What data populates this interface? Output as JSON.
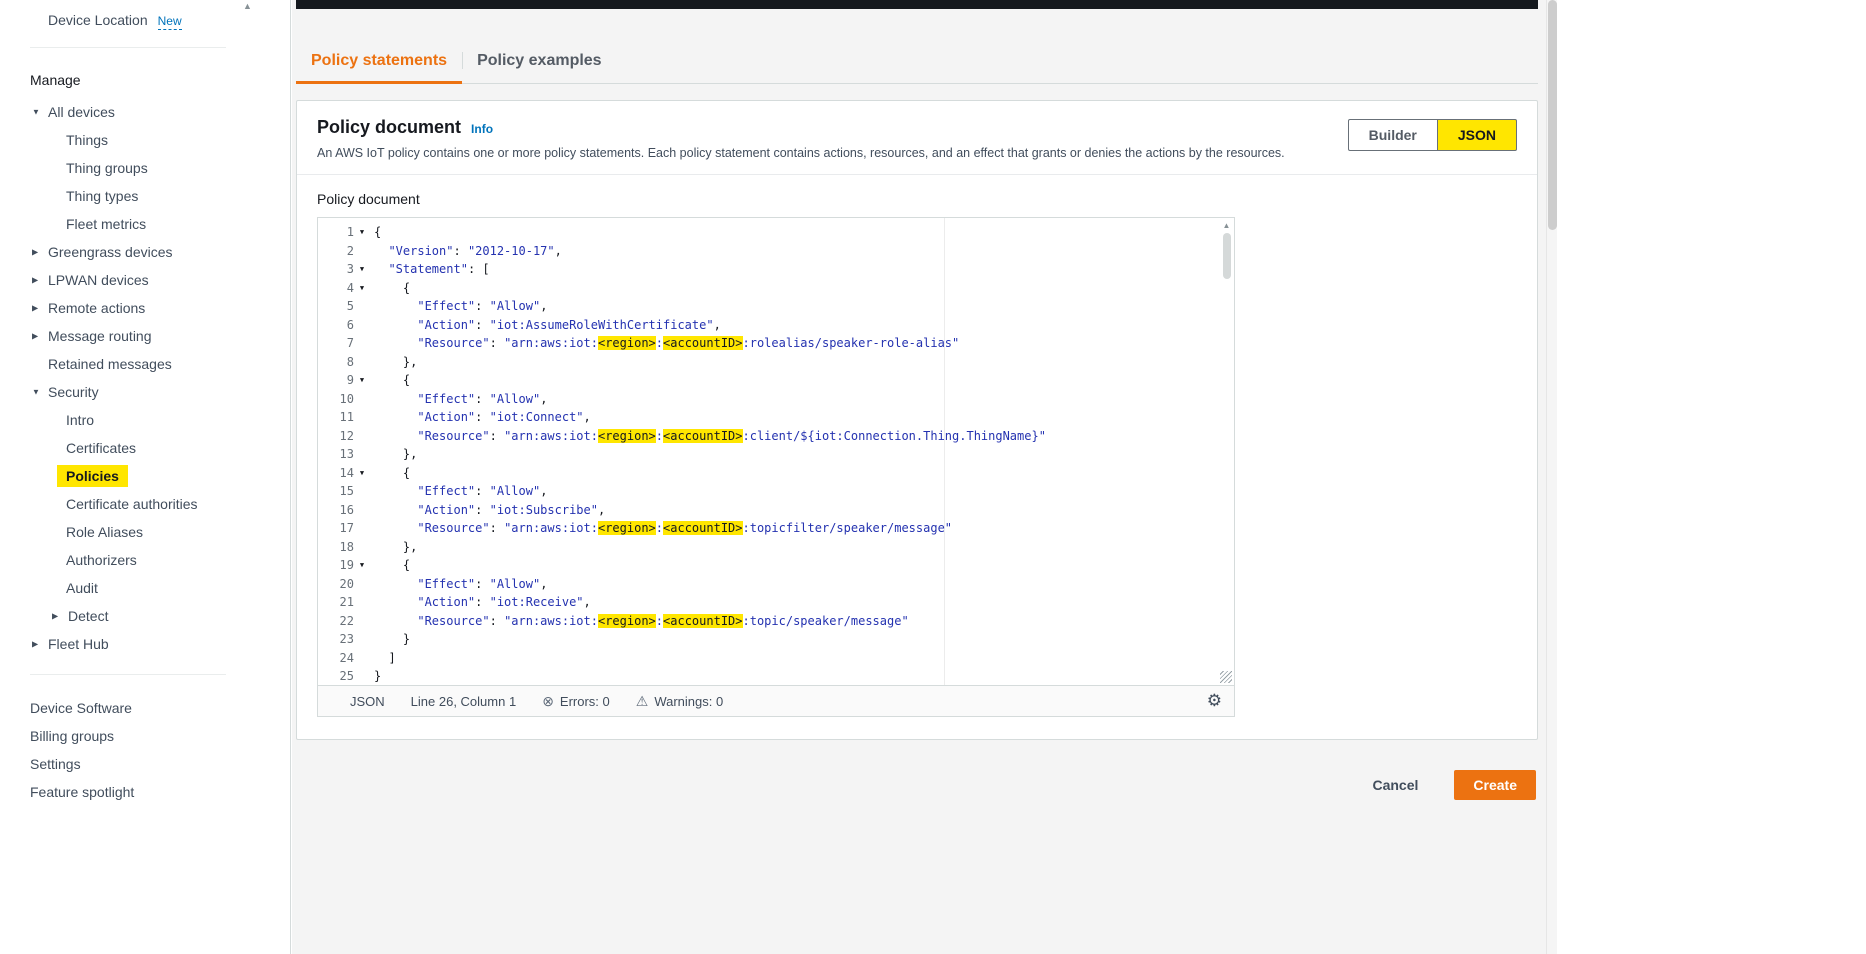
{
  "colors": {
    "accent_orange": "#ec7211",
    "annotation_highlight": "#ffe600",
    "link_blue": "#0073bb"
  },
  "sidebar": {
    "device_location": {
      "label": "Device Location",
      "badge": "New"
    },
    "section_manage": "Manage",
    "nav": [
      {
        "label": "All devices",
        "indent": 48,
        "arrow": "open"
      },
      {
        "label": "Things",
        "indent": 66
      },
      {
        "label": "Thing groups",
        "indent": 66
      },
      {
        "label": "Thing types",
        "indent": 66
      },
      {
        "label": "Fleet metrics",
        "indent": 66
      },
      {
        "label": "Greengrass devices",
        "indent": 48,
        "arrow": "closed"
      },
      {
        "label": "LPWAN devices",
        "indent": 48,
        "arrow": "closed"
      },
      {
        "label": "Remote actions",
        "indent": 48,
        "arrow": "closed"
      },
      {
        "label": "Message routing",
        "indent": 48,
        "arrow": "closed"
      },
      {
        "label": "Retained messages",
        "indent": 48
      },
      {
        "label": "Security",
        "indent": 48,
        "arrow": "open"
      },
      {
        "label": "Intro",
        "indent": 66
      },
      {
        "label": "Certificates",
        "indent": 66
      },
      {
        "label": "Policies",
        "indent": 66,
        "highlight": true
      },
      {
        "label": "Certificate authorities",
        "indent": 66
      },
      {
        "label": "Role Aliases",
        "indent": 66
      },
      {
        "label": "Authorizers",
        "indent": 66
      },
      {
        "label": "Audit",
        "indent": 66
      },
      {
        "label": "Detect",
        "indent": 68,
        "arrow": "closed"
      },
      {
        "label": "Fleet Hub",
        "indent": 48,
        "arrow": "closed"
      }
    ],
    "bottom": [
      "Device Software",
      "Billing groups",
      "Settings",
      "Feature spotlight"
    ]
  },
  "tabs": [
    {
      "label": "Policy statements",
      "active": true
    },
    {
      "label": "Policy examples",
      "active": false
    }
  ],
  "panel": {
    "title": "Policy document",
    "info_link": "Info",
    "description": "An AWS IoT policy contains one or more policy statements. Each policy statement contains actions, resources, and an effect that grants or denies the actions by the resources.",
    "view_toggle": [
      {
        "label": "Builder",
        "selected": false
      },
      {
        "label": "JSON",
        "selected": true
      }
    ],
    "editor_label": "Policy document"
  },
  "editor": {
    "fold_lines": [
      1,
      3,
      4,
      9,
      14,
      19
    ],
    "lines": [
      [
        [
          "p",
          "{"
        ]
      ],
      [
        [
          "p",
          "  "
        ],
        [
          "s",
          "\"Version\""
        ],
        [
          "p",
          ": "
        ],
        [
          "s",
          "\"2012-10-17\""
        ],
        [
          "p",
          ","
        ]
      ],
      [
        [
          "p",
          "  "
        ],
        [
          "s",
          "\"Statement\""
        ],
        [
          "p",
          ": ["
        ]
      ],
      [
        [
          "p",
          "    {"
        ]
      ],
      [
        [
          "p",
          "      "
        ],
        [
          "s",
          "\"Effect\""
        ],
        [
          "p",
          ": "
        ],
        [
          "s",
          "\"Allow\""
        ],
        [
          "p",
          ","
        ]
      ],
      [
        [
          "p",
          "      "
        ],
        [
          "s",
          "\"Action\""
        ],
        [
          "p",
          ": "
        ],
        [
          "s",
          "\"iot:AssumeRoleWithCertificate\""
        ],
        [
          "p",
          ","
        ]
      ],
      [
        [
          "p",
          "      "
        ],
        [
          "s",
          "\"Resource\""
        ],
        [
          "p",
          ": "
        ],
        [
          "s",
          "\"arn:aws:iot:"
        ],
        [
          "h",
          "<region>"
        ],
        [
          "s",
          ":"
        ],
        [
          "h",
          "<accountID>"
        ],
        [
          "s",
          ":rolealias/speaker-role-alias\""
        ]
      ],
      [
        [
          "p",
          "    },"
        ]
      ],
      [
        [
          "p",
          "    {"
        ]
      ],
      [
        [
          "p",
          "      "
        ],
        [
          "s",
          "\"Effect\""
        ],
        [
          "p",
          ": "
        ],
        [
          "s",
          "\"Allow\""
        ],
        [
          "p",
          ","
        ]
      ],
      [
        [
          "p",
          "      "
        ],
        [
          "s",
          "\"Action\""
        ],
        [
          "p",
          ": "
        ],
        [
          "s",
          "\"iot:Connect\""
        ],
        [
          "p",
          ","
        ]
      ],
      [
        [
          "p",
          "      "
        ],
        [
          "s",
          "\"Resource\""
        ],
        [
          "p",
          ": "
        ],
        [
          "s",
          "\"arn:aws:iot:"
        ],
        [
          "h",
          "<region>"
        ],
        [
          "s",
          ":"
        ],
        [
          "h",
          "<accountID>"
        ],
        [
          "s",
          ":client/${iot:Connection.Thing.ThingName}\""
        ]
      ],
      [
        [
          "p",
          "    },"
        ]
      ],
      [
        [
          "p",
          "    {"
        ]
      ],
      [
        [
          "p",
          "      "
        ],
        [
          "s",
          "\"Effect\""
        ],
        [
          "p",
          ": "
        ],
        [
          "s",
          "\"Allow\""
        ],
        [
          "p",
          ","
        ]
      ],
      [
        [
          "p",
          "      "
        ],
        [
          "s",
          "\"Action\""
        ],
        [
          "p",
          ": "
        ],
        [
          "s",
          "\"iot:Subscribe\""
        ],
        [
          "p",
          ","
        ]
      ],
      [
        [
          "p",
          "      "
        ],
        [
          "s",
          "\"Resource\""
        ],
        [
          "p",
          ": "
        ],
        [
          "s",
          "\"arn:aws:iot:"
        ],
        [
          "h",
          "<region>"
        ],
        [
          "s",
          ":"
        ],
        [
          "h",
          "<accountID>"
        ],
        [
          "s",
          ":topicfilter/speaker/message\""
        ]
      ],
      [
        [
          "p",
          "    },"
        ]
      ],
      [
        [
          "p",
          "    {"
        ]
      ],
      [
        [
          "p",
          "      "
        ],
        [
          "s",
          "\"Effect\""
        ],
        [
          "p",
          ": "
        ],
        [
          "s",
          "\"Allow\""
        ],
        [
          "p",
          ","
        ]
      ],
      [
        [
          "p",
          "      "
        ],
        [
          "s",
          "\"Action\""
        ],
        [
          "p",
          ": "
        ],
        [
          "s",
          "\"iot:Receive\""
        ],
        [
          "p",
          ","
        ]
      ],
      [
        [
          "p",
          "      "
        ],
        [
          "s",
          "\"Resource\""
        ],
        [
          "p",
          ": "
        ],
        [
          "s",
          "\"arn:aws:iot:"
        ],
        [
          "h",
          "<region>"
        ],
        [
          "s",
          ":"
        ],
        [
          "h",
          "<accountID>"
        ],
        [
          "s",
          ":topic/speaker/message\""
        ]
      ],
      [
        [
          "p",
          "    }"
        ]
      ],
      [
        [
          "p",
          "  ]"
        ]
      ],
      [
        [
          "p",
          "}"
        ]
      ]
    ],
    "status": {
      "mode": "JSON",
      "position": "Line 26, Column 1",
      "errors": "Errors: 0",
      "warnings": "Warnings: 0"
    }
  },
  "actions": {
    "cancel": "Cancel",
    "create": "Create"
  }
}
